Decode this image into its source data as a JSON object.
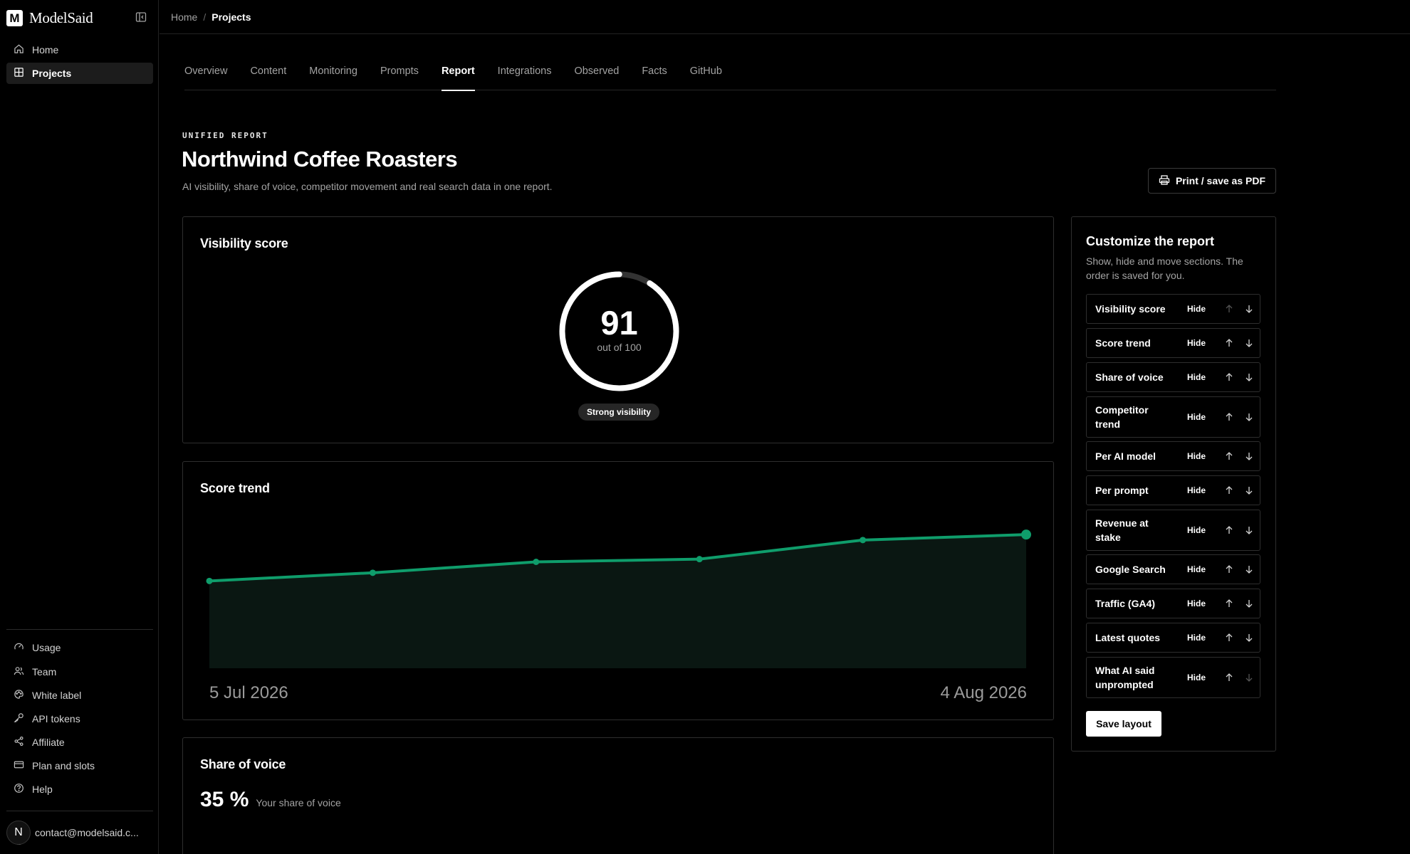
{
  "sidebar": {
    "brand": "ModelSaid",
    "brand_letter": "M",
    "nav": [
      {
        "label": "Home",
        "icon": "home-icon"
      },
      {
        "label": "Projects",
        "icon": "grid-icon",
        "active": true
      }
    ],
    "bottom_nav": [
      {
        "label": "Usage",
        "icon": "gauge-icon"
      },
      {
        "label": "Team",
        "icon": "users-icon"
      },
      {
        "label": "White label",
        "icon": "palette-icon"
      },
      {
        "label": "API tokens",
        "icon": "key-icon"
      },
      {
        "label": "Affiliate",
        "icon": "share-icon"
      },
      {
        "label": "Plan and slots",
        "icon": "card-icon"
      },
      {
        "label": "Help",
        "icon": "help-icon"
      }
    ],
    "user": {
      "initial": "N",
      "email": "contact@modelsaid.c..."
    }
  },
  "breadcrumb": {
    "home": "Home",
    "separator": "/",
    "current": "Projects"
  },
  "tabs": [
    "Overview",
    "Content",
    "Monitoring",
    "Prompts",
    "Report",
    "Integrations",
    "Observed",
    "Facts",
    "GitHub"
  ],
  "active_tab": "Report",
  "header": {
    "eyebrow": "UNIFIED REPORT",
    "title": "Northwind Coffee Roasters",
    "subtitle": "AI visibility, share of voice, competitor movement and real search data in one report.",
    "print_label": "Print / save as PDF"
  },
  "visibility": {
    "title": "Visibility score",
    "score": 91,
    "out_of_label": "out of 100",
    "max": 100,
    "badge": "Strong visibility"
  },
  "score_trend": {
    "title": "Score trend",
    "start_label": "5 Jul 2026",
    "end_label": "4 Aug 2026"
  },
  "chart_data": {
    "type": "area",
    "x": [
      "5 Jul 2026",
      "",
      "",
      "",
      "",
      "4 Aug 2026"
    ],
    "values": [
      72,
      75,
      79,
      80,
      87,
      89
    ],
    "ylim": [
      40,
      100
    ],
    "grid": false,
    "color": "#0f9d6b"
  },
  "share_of_voice": {
    "title": "Share of voice",
    "value": "35 %",
    "label": "Your share of voice"
  },
  "customize": {
    "title": "Customize the report",
    "subtitle": "Show, hide and move sections. The order is saved for you.",
    "hide_label": "Hide",
    "items": [
      "Visibility score",
      "Score trend",
      "Share of voice",
      "Competitor trend",
      "Per AI model",
      "Per prompt",
      "Revenue at stake",
      "Google Search",
      "Traffic (GA4)",
      "Latest quotes",
      "What AI said unprompted"
    ],
    "save_label": "Save layout"
  },
  "colors": {
    "accent": "#0f9d6b",
    "background": "#000000",
    "muted": "#a3a3a3",
    "border": "#2e2e2e"
  }
}
